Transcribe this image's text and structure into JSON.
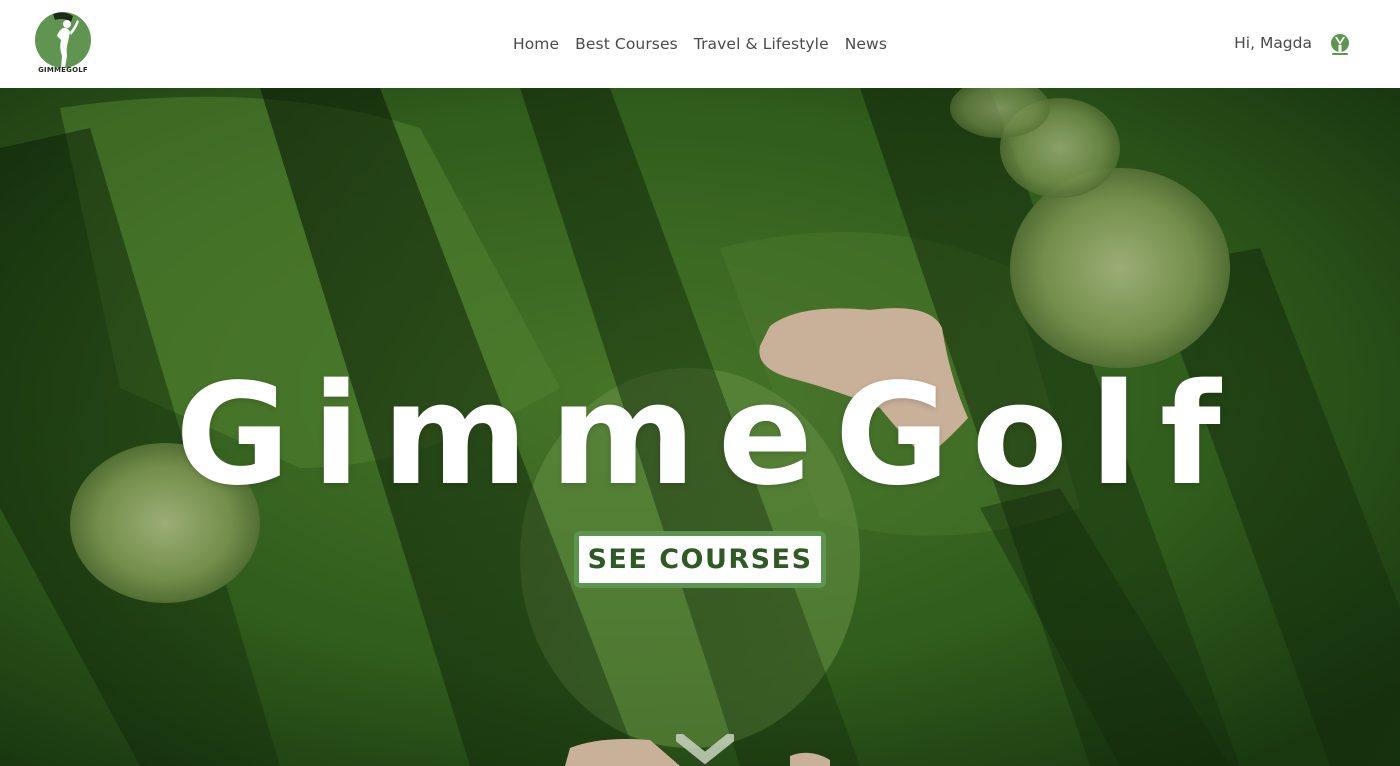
{
  "brand": {
    "logo_text": "GIMMEGOLF",
    "logo_color": "#5f9550"
  },
  "nav": {
    "items": [
      {
        "label": "Home"
      },
      {
        "label": "Best Courses"
      },
      {
        "label": "Travel & Lifestyle"
      },
      {
        "label": "News"
      }
    ]
  },
  "user": {
    "greeting": "Hi, Magda",
    "icon": "golf-tee-icon"
  },
  "hero": {
    "title": "GimmeGolf",
    "cta_label": "SEE COURSES",
    "scroll_icon": "chevron-down-icon",
    "accent_color": "#5c9450",
    "cta_text_color": "#2f5a23"
  }
}
